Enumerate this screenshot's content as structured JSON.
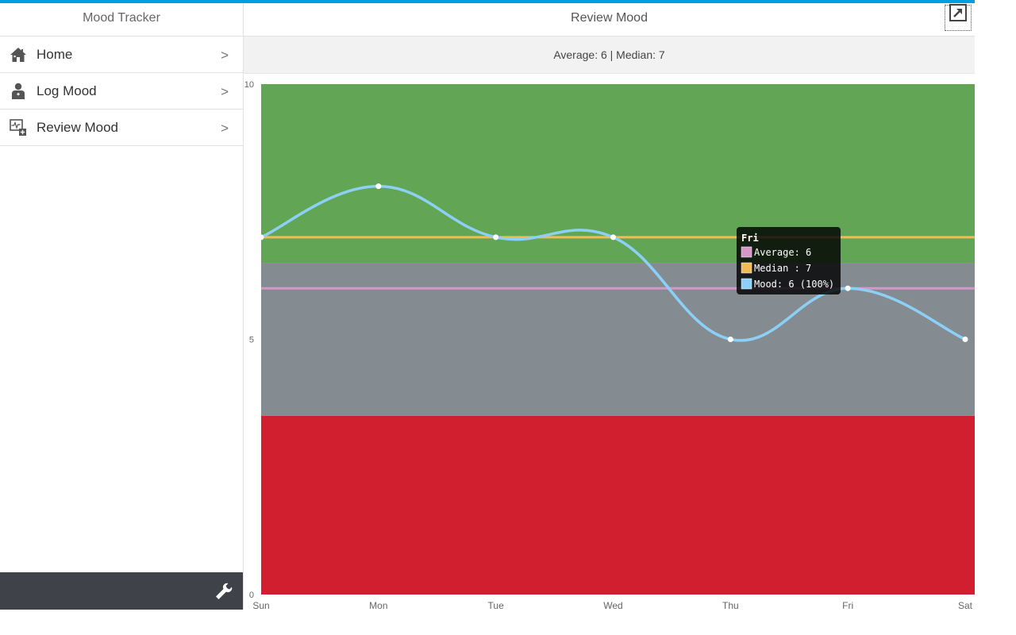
{
  "sidebar": {
    "title": "Mood Tracker",
    "items": [
      {
        "label": "Home",
        "icon": "home-icon"
      },
      {
        "label": "Log Mood",
        "icon": "doctor-icon"
      },
      {
        "label": "Review Mood",
        "icon": "health-monitor-icon"
      }
    ],
    "chevron": ">",
    "footer_icon": "wrench-icon"
  },
  "main": {
    "title": "Review Mood",
    "expand_icon": "expand-icon",
    "summary": "Average: 6 | Median: 7"
  },
  "colors": {
    "accent": "#009de0",
    "band_good": "#62a655",
    "band_neutral": "#858c91",
    "band_bad": "#d21f30",
    "mood_line": "#8dd0f7",
    "average_line": "#d597c8",
    "median_line": "#f3bb55"
  },
  "chart_data": {
    "type": "line",
    "categories": [
      "Sun",
      "Mon",
      "Tue",
      "Wed",
      "Thu",
      "Fri",
      "Sat"
    ],
    "y_ticks": [
      "0",
      "5",
      "10"
    ],
    "ylim": [
      0,
      10
    ],
    "bands": [
      {
        "from": 0,
        "to": 3.5,
        "color": "#d21f30"
      },
      {
        "from": 3.5,
        "to": 6.5,
        "color": "#858c91"
      },
      {
        "from": 6.5,
        "to": 10,
        "color": "#62a655"
      }
    ],
    "series": [
      {
        "name": "Mood",
        "values": [
          7,
          8,
          7,
          7,
          5,
          6,
          5
        ],
        "color": "#8dd0f7"
      },
      {
        "name": "Average",
        "values": [
          6,
          6,
          6,
          6,
          6,
          6,
          6
        ],
        "color": "#d597c8"
      },
      {
        "name": "Median",
        "values": [
          7,
          7,
          7,
          7,
          7,
          7,
          7
        ],
        "color": "#f3bb55"
      }
    ],
    "tooltip": {
      "title": "Fri",
      "lines": [
        "Average: 6",
        "Median : 7",
        "Mood: 6 (100%)"
      ]
    }
  }
}
